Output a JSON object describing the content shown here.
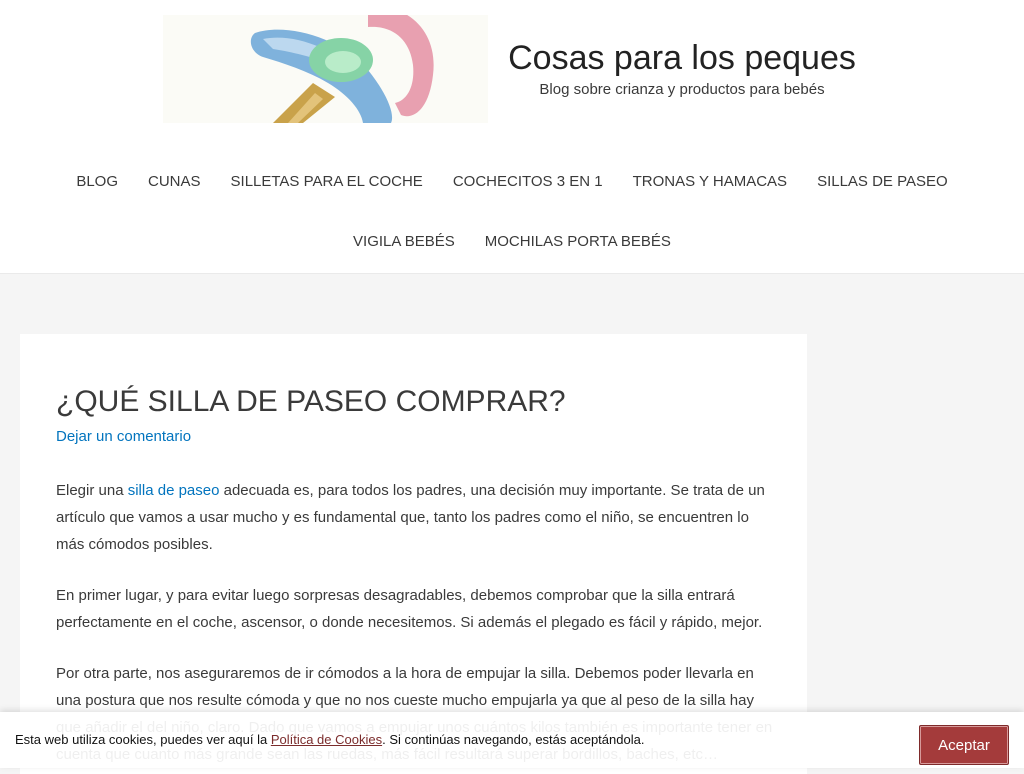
{
  "header": {
    "site_title": "Cosas para los peques",
    "tagline": "Blog sobre crianza y productos para bebés"
  },
  "nav": {
    "row1": [
      {
        "label": "BLOG"
      },
      {
        "label": "CUNAS"
      },
      {
        "label": "SILLETAS PARA EL COCHE"
      },
      {
        "label": "COCHECITOS 3 EN 1"
      },
      {
        "label": "TRONAS Y HAMACAS"
      },
      {
        "label": "SILLAS DE PASEO"
      }
    ],
    "row2": [
      {
        "label": "VIGILA BEBÉS"
      },
      {
        "label": "MOCHILAS PORTA BEBÉS"
      }
    ]
  },
  "article": {
    "title": "¿QUÉ SILLA DE PASEO COMPRAR?",
    "comment_link": "Dejar un comentario",
    "p1": {
      "before": "Elegir una ",
      "link": "silla de paseo",
      "after": " adecuada es, para todos los padres, una decisión muy importante. Se trata de un artículo que vamos a usar mucho y es fundamental que, tanto los padres como el niño, se encuentren lo más cómodos posibles."
    },
    "p2": "En primer lugar, y para evitar luego sorpresas desagradables, debemos comprobar que la silla entrará perfectamente en el coche, ascensor, o donde necesitemos. Si además el plegado es fácil y rápido, mejor.",
    "p3": "Por otra parte, nos aseguraremos de ir cómodos a la hora de empujar la silla. Debemos poder llevarla en una postura que nos resulte cómoda y que no nos cueste mucho empujarla ya que al peso de la silla hay que añadir el del niño, claro. Dado que vamos a empujar unos cuántos kilos también es importante tener en cuenta que cuanto más grande sean las ruedas, más fácil resultará superar bordillos, baches, etc…"
  },
  "cookie": {
    "text_before": "Esta web utiliza cookies, puedes ver aquí la ",
    "link": "Política de Cookies",
    "text_after": ". Si continúas navegando, estás aceptándola.",
    "accept_label": "Aceptar"
  },
  "colors": {
    "link": "#0274be",
    "accept_button": "#a43b3b",
    "page_background": "#f5f5f5"
  },
  "icons": {
    "logo": "pacifier-logo"
  }
}
